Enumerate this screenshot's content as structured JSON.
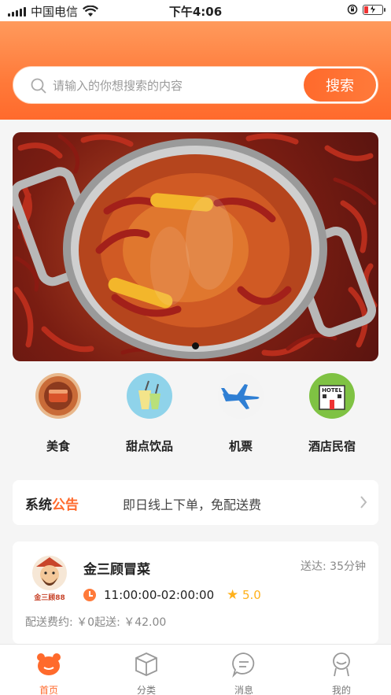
{
  "status_bar": {
    "carrier": "中国电信",
    "time": "下午4:06"
  },
  "search": {
    "placeholder": "请输入的你想搜索的内容",
    "button_label": "搜索"
  },
  "banner": {
    "page_count": 1,
    "active_page": 1
  },
  "categories": [
    {
      "label": "美食",
      "icon": "food-icon"
    },
    {
      "label": "甜点饮品",
      "icon": "drinks-icon"
    },
    {
      "label": "机票",
      "icon": "airplane-icon"
    },
    {
      "label": "酒店民宿",
      "icon": "hotel-icon",
      "icon_text": "HOTEL"
    }
  ],
  "notice": {
    "title_part1": "系统",
    "title_part2": "公告",
    "text": "即日线上下单，免配送费"
  },
  "shop": {
    "name": "金三顾冒菜",
    "logo_text": "金三顾88",
    "delivery_label": "送达:",
    "delivery_time": "35分钟",
    "hours": "11:00:00-02:00:00",
    "rating": "5.0",
    "fee_text": "配送费约: ￥0起送: ￥42.00"
  },
  "tabbar": [
    {
      "label": "首页",
      "icon": "home-bear-icon",
      "active": true
    },
    {
      "label": "分类",
      "icon": "box-icon",
      "active": false
    },
    {
      "label": "消息",
      "icon": "message-icon",
      "active": false
    },
    {
      "label": "我的",
      "icon": "profile-icon",
      "active": false
    }
  ],
  "colors": {
    "accent": "#ff6a2c",
    "star": "#ffb11b"
  }
}
